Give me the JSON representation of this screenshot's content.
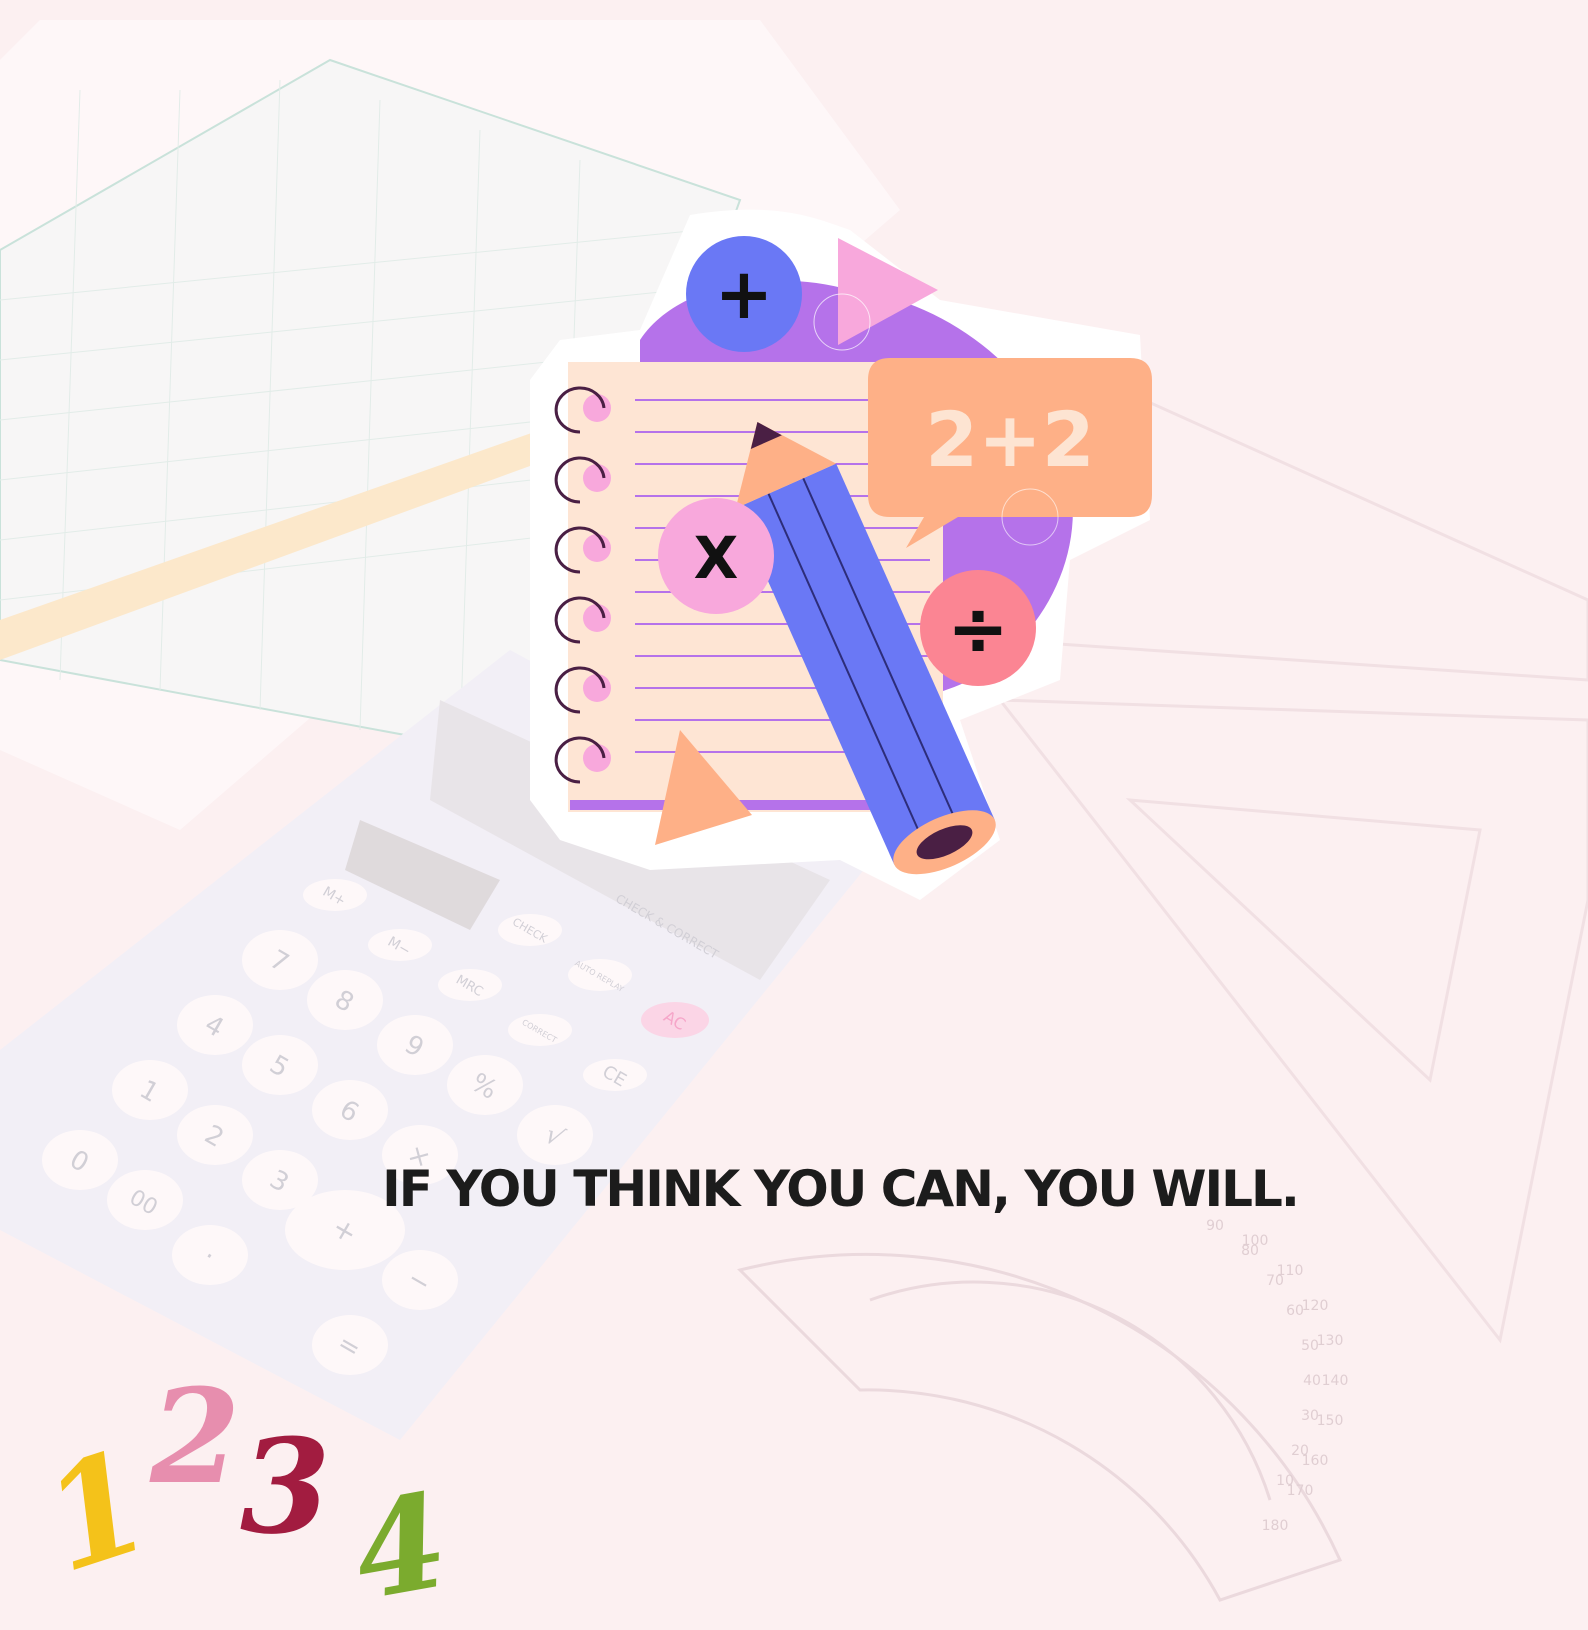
{
  "quote": "IF YOU THINK YOU CAN, YOU WILL.",
  "illustration": {
    "speech_bubble_text": "2+2",
    "plus_symbol": "+",
    "times_symbol": "X",
    "divide_symbol": "÷"
  },
  "decorative_numbers": [
    "1",
    "2",
    "3",
    "4"
  ],
  "calculator_keys": {
    "m_plus": "M+",
    "m_minus": "M−",
    "check": "CHECK",
    "mrc": "MRC",
    "auto_replay": "AUTO REPLAY",
    "ac": "AC",
    "correct": "CORRECT",
    "ce": "CE",
    "percent": "%",
    "sqrt": "√",
    "times": "×",
    "minus": "−",
    "plus": "+",
    "equals": "=",
    "dot": "·",
    "n0": "0",
    "n00": "00",
    "n1": "1",
    "n2": "2",
    "n3": "3",
    "n4": "4",
    "n5": "5",
    "n6": "6",
    "n7": "7",
    "n8": "8",
    "n9": "9",
    "brand": "CHECK & CORRECT"
  },
  "protractor_labels": [
    "90",
    "100",
    "110",
    "120",
    "130",
    "140",
    "150",
    "160",
    "170",
    "180",
    "80",
    "70",
    "60",
    "50",
    "40",
    "30",
    "20",
    "10"
  ],
  "colors": {
    "background": "#fcf0f1",
    "purple": "#b572ea",
    "blue": "#6a78f5",
    "pink": "#f8a8dc",
    "peach": "#feb087",
    "coral": "#fb8593",
    "paper": "#fee5d4",
    "dark": "#1c1c1c",
    "digit_1": "#f4c21a",
    "digit_2": "#e78eae",
    "digit_3": "#a21c40",
    "digit_4": "#7bab2e"
  }
}
